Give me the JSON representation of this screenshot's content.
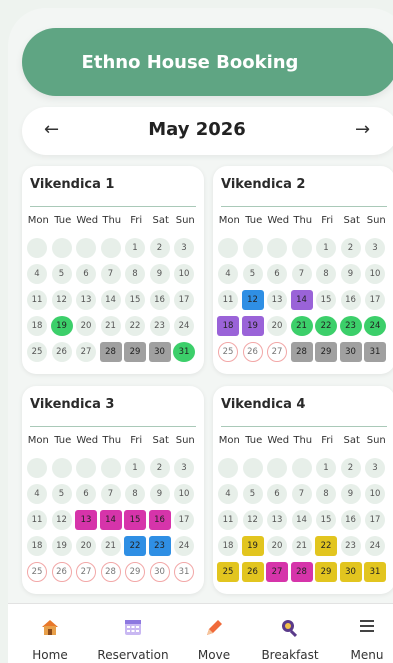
{
  "app": {
    "title": "Ethno House Booking"
  },
  "month": {
    "label": "May 2026",
    "prev": "←",
    "next": "→"
  },
  "weekdays": [
    "Mon",
    "Tue",
    "Wed",
    "Thu",
    "Fri",
    "Sat",
    "Sun"
  ],
  "colors": {
    "green": "#3ccf6a",
    "gray": "#a0a0a0",
    "blue": "#2f8fe4",
    "purple": "#9a63d8",
    "magenta": "#d634aa",
    "yellow": "#e2c51f"
  },
  "houses": [
    {
      "name": "Vikendica 1",
      "booked": {
        "19": "green",
        "28": "gray",
        "29": "gray",
        "30": "gray",
        "31": "green"
      },
      "past": []
    },
    {
      "name": "Vikendica 2",
      "booked": {
        "12": "blue",
        "14": "purple",
        "18": "purple",
        "19": "purple",
        "21": "green",
        "22": "green",
        "23": "green",
        "24": "green",
        "28": "gray",
        "29": "gray",
        "30": "gray",
        "31": "gray"
      },
      "past": [
        "25",
        "26",
        "27"
      ]
    },
    {
      "name": "Vikendica 3",
      "booked": {
        "13": "magenta",
        "14": "magenta",
        "15": "magenta",
        "16": "magenta",
        "22": "blue",
        "23": "blue"
      },
      "past": [
        "25",
        "26",
        "27",
        "28",
        "29",
        "30",
        "31"
      ]
    },
    {
      "name": "Vikendica 4",
      "booked": {
        "19": "yellow",
        "22": "yellow",
        "25": "yellow",
        "26": "yellow",
        "27": "magenta",
        "28": "magenta",
        "29": "yellow",
        "30": "yellow",
        "31": "yellow"
      },
      "past": []
    }
  ],
  "nav": [
    {
      "label": "Home",
      "icon": "house-icon"
    },
    {
      "label": "Reservation",
      "icon": "calendar-icon"
    },
    {
      "label": "Move",
      "icon": "pencil-icon"
    },
    {
      "label": "Breakfast",
      "icon": "search-food-icon"
    },
    {
      "label": "Menu",
      "icon": "hamburger-icon"
    }
  ]
}
